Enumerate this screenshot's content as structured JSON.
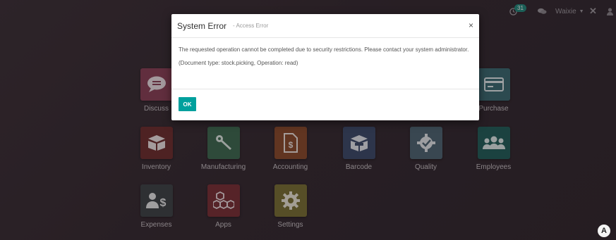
{
  "topbar": {
    "chat_count": "31",
    "user_name": "Waixie"
  },
  "apps": [
    {
      "label": "Discuss",
      "color": "#8a3f56",
      "icon": "speech-bubble-icon"
    },
    {
      "label": "Purchase",
      "color": "#3a6a72",
      "icon": "credit-card-icon"
    },
    {
      "label": "Inventory",
      "color": "#6e2d2d",
      "icon": "box-icon"
    },
    {
      "label": "Manufacturing",
      "color": "#3d6a50",
      "icon": "wrench-icon"
    },
    {
      "label": "Accounting",
      "color": "#8a4a2a",
      "icon": "invoice-dollar-icon"
    },
    {
      "label": "Barcode",
      "color": "#3b4a6b",
      "icon": "barcode-box-icon"
    },
    {
      "label": "Quality",
      "color": "#4d6673",
      "icon": "gear-check-icon"
    },
    {
      "label": "Employees",
      "color": "#1f5f5a",
      "icon": "people-icon"
    },
    {
      "label": "Expenses",
      "color": "#3c4346",
      "icon": "user-dollar-icon"
    },
    {
      "label": "Apps",
      "color": "#7a2f35",
      "icon": "cubes-icon"
    },
    {
      "label": "Settings",
      "color": "#7a7034",
      "icon": "gear-icon"
    }
  ],
  "dialog": {
    "title": "System Error",
    "subtitle": "- Access Error",
    "message": "The requested operation cannot be completed due to security restrictions. Please contact your system administrator.",
    "detail": "(Document type: stock.picking, Operation: read)",
    "ok_label": "OK",
    "close_symbol": "×"
  },
  "corner_badge": "A"
}
